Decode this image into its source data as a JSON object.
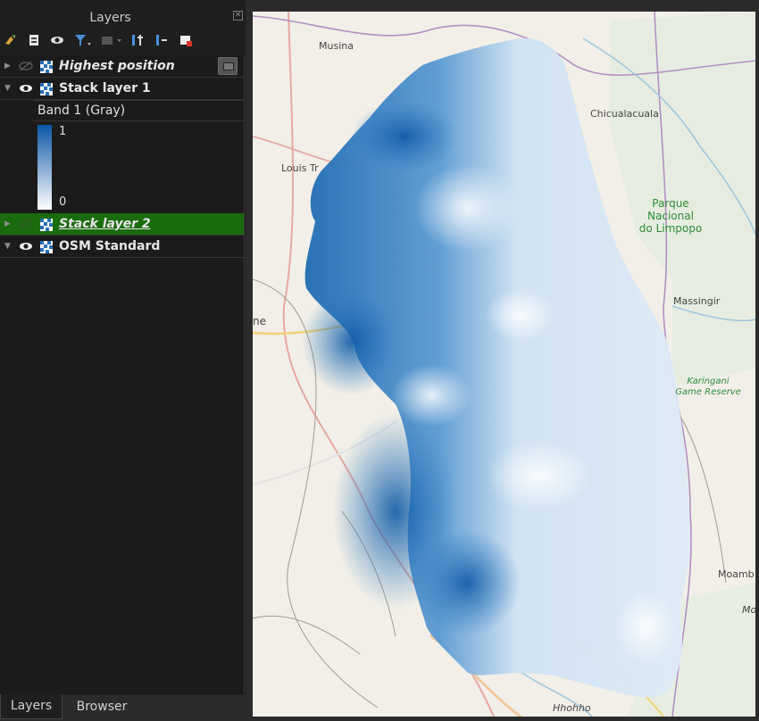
{
  "panel": {
    "title": "Layers"
  },
  "toolbar": {
    "icons": [
      "style-manager-icon",
      "add-group-icon",
      "manage-visibility-icon",
      "filter-legend-icon",
      "filter-by-expression-icon",
      "expand-all-icon",
      "collapse-all-icon",
      "remove-layer-icon"
    ]
  },
  "layers": [
    {
      "name": "Highest position",
      "visible": false,
      "expanded": false,
      "selected": false,
      "style": "italic"
    },
    {
      "name": "Stack layer 1",
      "visible": true,
      "expanded": true,
      "selected": false,
      "style": "normal"
    },
    {
      "name": "Stack layer 2",
      "visible": false,
      "expanded": false,
      "selected": true,
      "style": "italic-underline"
    },
    {
      "name": "OSM Standard",
      "visible": true,
      "expanded": true,
      "selected": false,
      "style": "normal"
    }
  ],
  "legend": {
    "band": "Band 1 (Gray)",
    "max": "1",
    "min": "0",
    "ramp_top_color": "#0b57a6",
    "ramp_bottom_color": "#ffffff"
  },
  "tabs": [
    {
      "label": "Layers",
      "active": true
    },
    {
      "label": "Browser",
      "active": false
    }
  ],
  "map": {
    "labels": {
      "musina": "Musina",
      "chicualacuala": "Chicualacuala",
      "louis_trichardt": "Louis Tr",
      "parque_line1": "Parque",
      "parque_line2": "Nacional",
      "parque_line3": "do Limpopo",
      "massingir": "Massingir",
      "ne": "ne",
      "karingani_line1": "Karingani",
      "karingani_line2": "Game Reserve",
      "moamba": "Moamb",
      "mo": "Mo",
      "hhohho": "Hhohho"
    }
  }
}
